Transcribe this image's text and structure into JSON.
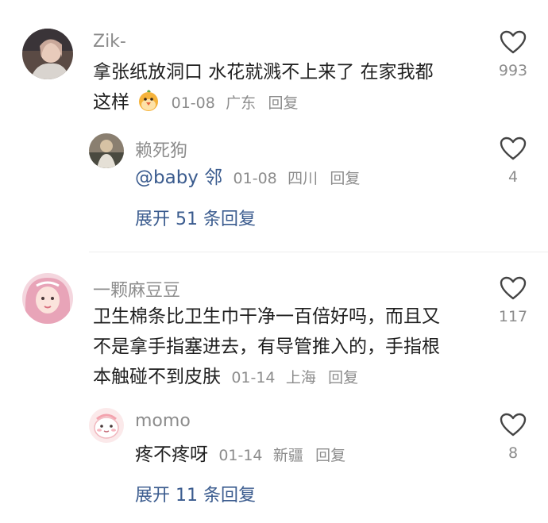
{
  "comments": [
    {
      "user": "Zik-",
      "line1": "拿张纸放洞口 水花就溅不上来了 在家我都",
      "line2": "这样",
      "emoji_icon": "smiling-chick-emoji",
      "date": "01-08",
      "location": "广东",
      "reply_label": "回复",
      "likes": "993",
      "reply": {
        "user": "赖死狗",
        "mention": "@baby 邻",
        "date": "01-08",
        "location": "四川",
        "reply_label": "回复",
        "likes": "4"
      },
      "expand_label": "展开 51 条回复"
    },
    {
      "user": "一颗麻豆豆",
      "line1": "卫生棉条比卫生巾干净一百倍好吗，而且又",
      "line2": "不是拿手指塞进去，有导管推入的，手指根",
      "line3": "本触碰不到皮肤",
      "date": "01-14",
      "location": "上海",
      "reply_label": "回复",
      "likes": "117",
      "reply": {
        "user": "momo",
        "text": "疼不疼呀",
        "date": "01-14",
        "location": "新疆",
        "reply_label": "回复",
        "likes": "8"
      },
      "expand_label": "展开 11 条回复"
    }
  ],
  "icons": {
    "like": "heart-outline-icon"
  },
  "colors": {
    "link": "#3a5b8e",
    "secondary_text": "#8c8c8c"
  }
}
